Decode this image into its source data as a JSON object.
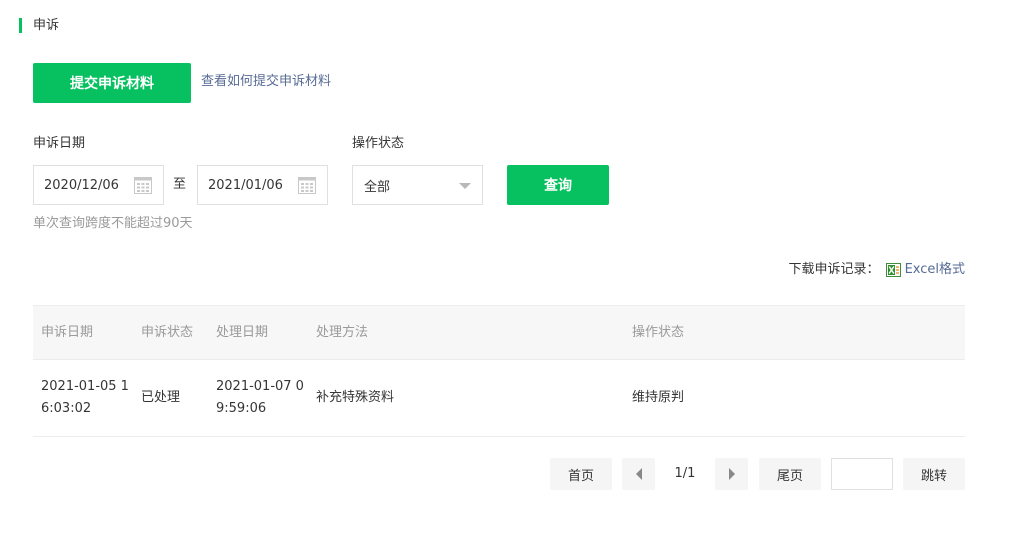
{
  "section": {
    "title": "申诉"
  },
  "actions": {
    "submit_label": "提交申诉材料",
    "help_link": "查看如何提交申诉材料"
  },
  "filters": {
    "date_label": "申诉日期",
    "start_date": "2020/12/06",
    "to_label": "至",
    "end_date": "2021/01/06",
    "status_label": "操作状态",
    "status_value": "全部",
    "query_label": "查询",
    "hint": "单次查询跨度不能超过90天"
  },
  "download": {
    "label": "下载申诉记录：",
    "link": "Excel格式"
  },
  "table": {
    "headers": [
      "申诉日期",
      "申诉状态",
      "处理日期",
      "处理方法",
      "操作状态"
    ],
    "rows": [
      [
        "2021-01-05 16:03:02",
        "已处理",
        "2021-01-07 09:59:06",
        "补充特殊资料",
        "维持原判"
      ]
    ]
  },
  "pagination": {
    "first": "首页",
    "info": "1/1",
    "last": "尾页",
    "jump": "跳转"
  },
  "colors": {
    "accent": "#07c160",
    "link": "#576b95"
  },
  "icons": [
    "calendar-icon",
    "caret-down-icon",
    "excel-icon",
    "prev-page-icon",
    "next-page-icon"
  ]
}
